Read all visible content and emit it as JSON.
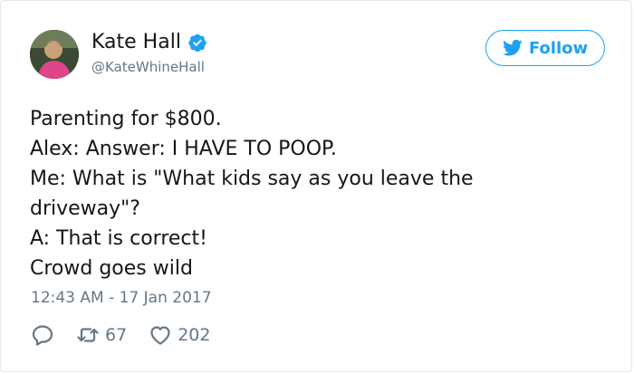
{
  "user": {
    "display_name": "Kate Hall",
    "handle": "@KateWhineHall"
  },
  "follow_button": {
    "label": "Follow"
  },
  "tweet": {
    "lines": [
      "Parenting for $800.",
      "Alex: Answer: I HAVE TO POOP.",
      "Me: What is \"What kids say as you leave the",
      "driveway\"?",
      "A: That is correct!",
      "Crowd goes wild"
    ],
    "timestamp": "12:43 AM - 17 Jan 2017"
  },
  "actions": {
    "reply": {
      "icon": "reply-icon"
    },
    "retweet": {
      "icon": "retweet-icon",
      "count": "67"
    },
    "like": {
      "icon": "heart-icon",
      "count": "202"
    }
  },
  "colors": {
    "accent": "#1da1f2",
    "text": "#14171a",
    "muted": "#657786",
    "border": "#e1e8ed"
  }
}
